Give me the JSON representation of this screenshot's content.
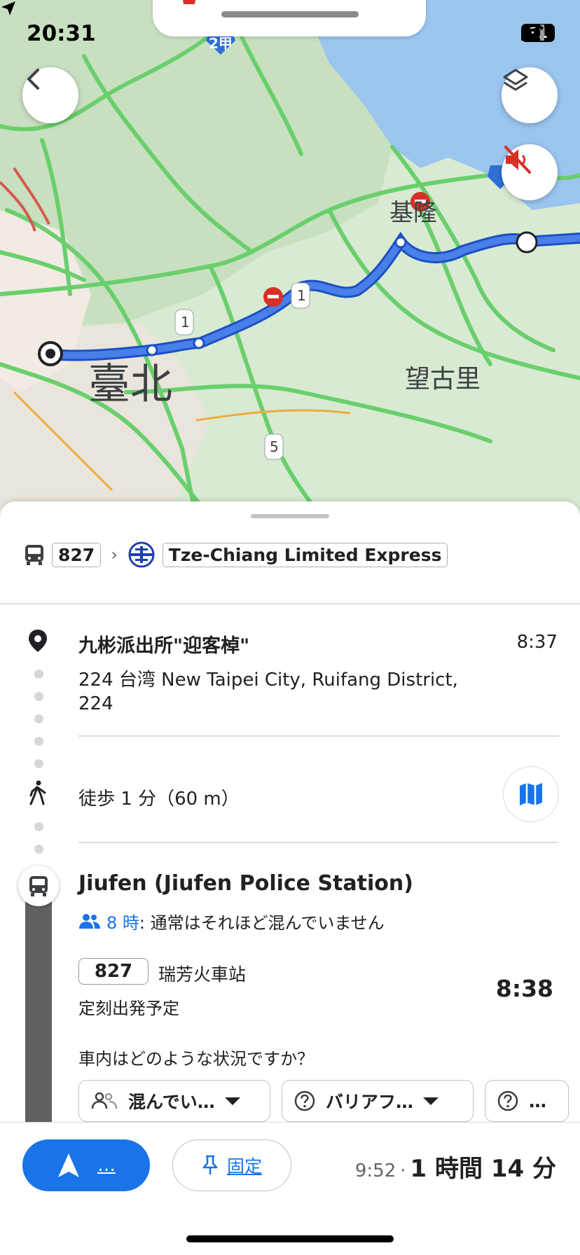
{
  "status_bar": {
    "time": "20:31",
    "battery": "81",
    "icons": [
      "location-arrow-icon",
      "signal-icon",
      "wifi-icon",
      "battery-icon"
    ]
  },
  "map": {
    "labels": {
      "taipei": "臺北",
      "keelung": "基隆",
      "wangguli": "望古里",
      "shield_2": "2甲",
      "shield_1a": "1",
      "shield_1b": "1",
      "shield_5": "5"
    },
    "colors": {
      "route": "#2b62d8",
      "traffic_green": "#69cf6c",
      "water": "#9ac5ef",
      "land": "#d8ead2"
    },
    "buttons": {
      "back": "back-icon",
      "layers": "layers-icon",
      "mute": "mute-icon"
    }
  },
  "route_summary": {
    "bus_number": "827",
    "train_name": "Tze-Chiang Limited Express"
  },
  "origin": {
    "name": "九彬派出所\"迎客棹\"",
    "time": "8:37",
    "address": "224 台湾 New Taipei City, Ruifang District, 224"
  },
  "walk": {
    "text": "徒歩 1 分（60 m）"
  },
  "stop": {
    "name": "Jiufen (Jiufen Police Station)",
    "crowd_time": "8 時",
    "crowd_text": ": 通常はそれほど混んでいません",
    "route": "827",
    "destination": "瑞芳火車站",
    "depart_time": "8:38",
    "scheduled": "定刻出発予定",
    "question": "車内はどのような状況ですか？",
    "feedback": [
      {
        "label": "混んでい…"
      },
      {
        "label": "バリアフ…"
      },
      {
        "label": "…"
      }
    ]
  },
  "bottom": {
    "start_label": "…",
    "pin_label": "固定",
    "arrive": "9:52",
    "dot": "·",
    "duration": "1 時間 14 分"
  }
}
